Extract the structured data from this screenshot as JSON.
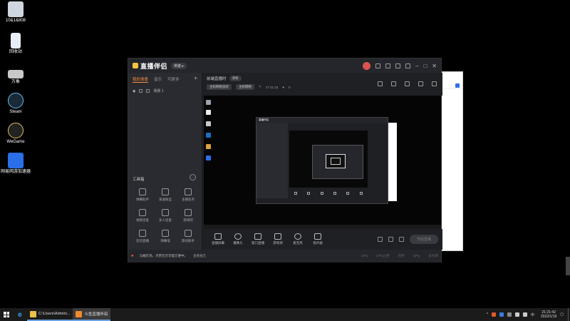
{
  "desktop": {
    "icons": [
      {
        "label": "10&1&808",
        "icon": "monitor-icon",
        "color": "#cfd6e0"
      },
      {
        "label": "回收站",
        "icon": "recycle-bin-icon",
        "color": "#e8eef5"
      },
      {
        "label": "万象",
        "icon": "drive-icon",
        "color": "#c8c8c8"
      },
      {
        "label": "Steam",
        "icon": "steam-icon",
        "color": "#1b2838"
      },
      {
        "label": "WeGame",
        "icon": "wegame-icon",
        "color": "#222222"
      },
      {
        "label": "网易网游加速器",
        "icon": "uu-accelerator-icon",
        "color": "#2a6fe8"
      }
    ]
  },
  "app": {
    "title": "直播伴侣",
    "title_badge": "英雄 ▸",
    "left_tabs": [
      "我的场景",
      "音乐",
      "可更多"
    ],
    "scene_name": "场景 1",
    "tools_title": "工具箱",
    "tools": [
      {
        "label": "弹幕助手",
        "icon": "danmaku-icon",
        "hot": false
      },
      {
        "label": "发送粉丝",
        "icon": "fans-icon",
        "hot": false
      },
      {
        "label": "主播任务",
        "icon": "task-icon",
        "hot": false
      },
      {
        "label": "视频连麦",
        "icon": "video-link-icon",
        "hot": false
      },
      {
        "label": "多人连麦",
        "icon": "multi-link-icon",
        "hot": false
      },
      {
        "label": "游戏吧",
        "icon": "game-icon",
        "hot": false
      },
      {
        "label": "连切直播",
        "icon": "switch-icon",
        "hot": false
      },
      {
        "label": "弹幕墙",
        "icon": "wall-icon",
        "hot": false
      },
      {
        "label": "歌词助手",
        "icon": "lyrics-icon",
        "hot": false
      },
      {
        "label": "",
        "icon": "live-hot-icon",
        "hot": true
      },
      {
        "label": "",
        "icon": "download-icon",
        "hot": false
      },
      {
        "label": "",
        "icon": "more-tool-icon",
        "hot": false
      }
    ],
    "preview_title": "前端直播时",
    "preview_tag": "清晰",
    "preview_chips": [
      "主机网络良好",
      "主机网络"
    ],
    "preview_time": "17:21:23",
    "preview_count": "0",
    "nested_title": "直播伴侣",
    "controls": [
      {
        "label": "直播屏幕",
        "icon": "screen-share-icon"
      },
      {
        "label": "摄像头",
        "icon": "camera-icon"
      },
      {
        "label": "窗口直播",
        "icon": "window-capture-icon"
      },
      {
        "label": "游戏源",
        "icon": "game-source-icon"
      },
      {
        "label": "麦克风",
        "icon": "microphone-icon"
      },
      {
        "label": "扬声器",
        "icon": "speaker-icon"
      }
    ],
    "start_live": "开始直播",
    "status": {
      "msg": "马桶在场，点赞告示可能方便中，",
      "link": "查看报告",
      "stats": [
        "CPU",
        "CPU占用",
        "内存",
        "GPU",
        "丢包率"
      ]
    }
  },
  "taskbar": {
    "items": [
      {
        "label": "C:\\Users\\Admini...",
        "color": "#e8c14a",
        "active": false
      },
      {
        "label": "斗鱼直播伴侣",
        "color": "#f08a2c",
        "active": true
      }
    ],
    "time": "21:21:42",
    "date": "2022/1/19"
  },
  "colors": {
    "accent": "#ff8a3d",
    "warn": "#ff5a4a"
  }
}
